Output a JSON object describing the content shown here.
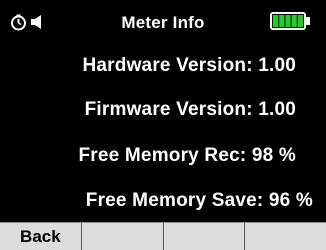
{
  "header": {
    "title": "Meter Info",
    "icons": [
      "timer-icon",
      "speaker-icon",
      "battery-icon"
    ],
    "battery_color": "#22cc22",
    "battery_level": 1.0
  },
  "info": {
    "hardware_version": "Hardware Version: 1.00",
    "firmware_version": "Firmware Version: 1.00",
    "free_memory_rec": "Free Memory Rec: 98 %",
    "free_memory_save": "Free Memory Save: 96 %"
  },
  "softkeys": [
    "Back",
    "",
    "",
    ""
  ]
}
